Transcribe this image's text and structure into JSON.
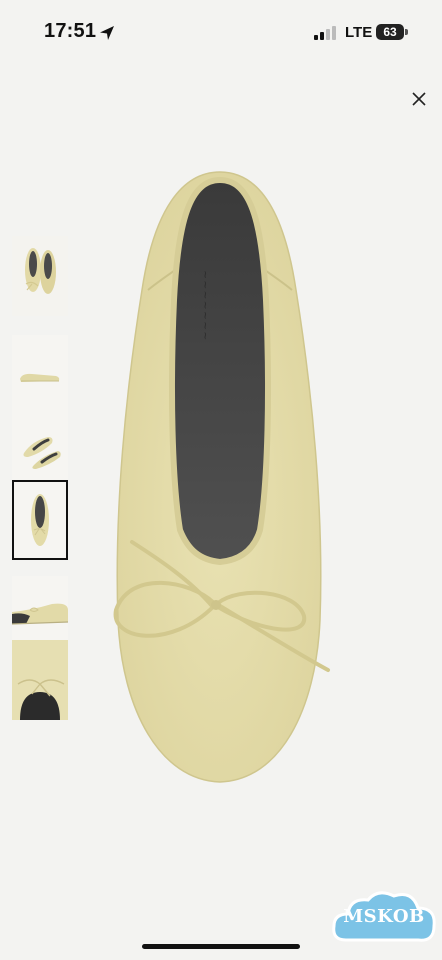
{
  "status_bar": {
    "time": "17:51",
    "network": "LTE",
    "battery": "63"
  },
  "product_viewer": {
    "close_icon": "close-icon",
    "selected_thumbnail": 4,
    "thumbnails": [
      {
        "view": "pair-front"
      },
      {
        "view": "side-profile"
      },
      {
        "view": "angled-pair"
      },
      {
        "view": "top-down"
      },
      {
        "view": "side-detail"
      },
      {
        "view": "toe-closeup"
      }
    ],
    "colors": {
      "suede": "#e3dba8",
      "insole": "#454545",
      "background": "#f3f3f1"
    }
  },
  "watermark": {
    "text": "MSKOB"
  }
}
